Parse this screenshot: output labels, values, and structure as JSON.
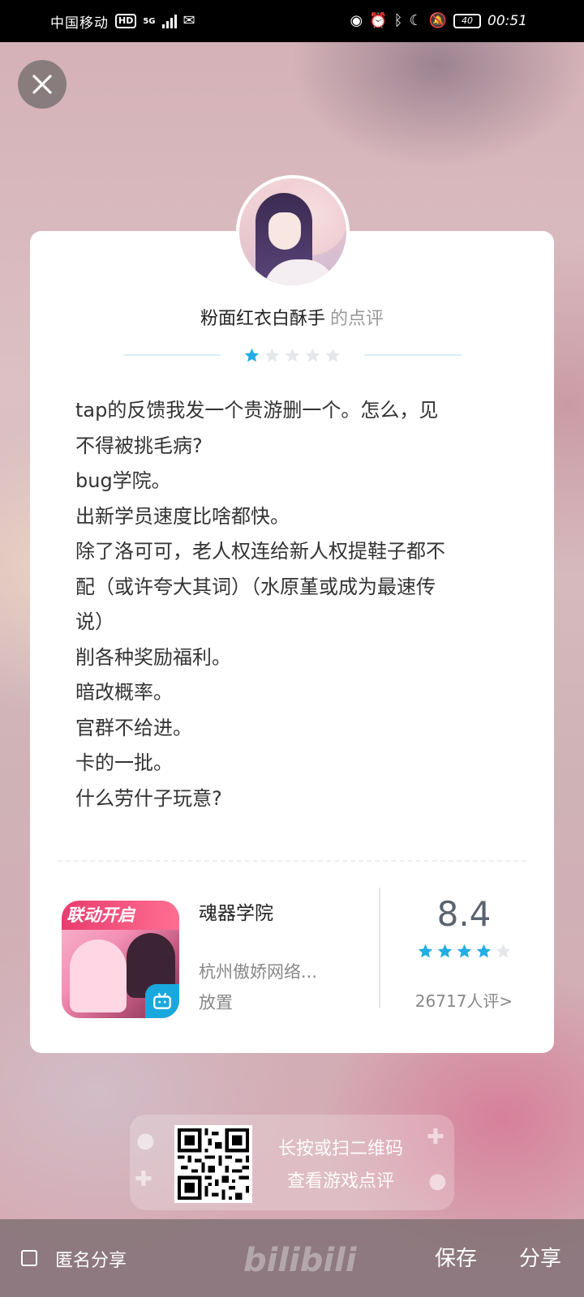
{
  "status_bar": {
    "carrier": "中国移动",
    "hd": "HD",
    "network": "5G",
    "battery": "40",
    "time": "00:51"
  },
  "review": {
    "reviewer": "粉面红衣白酥手",
    "suffix": "的点评",
    "rating_stars": 1,
    "text_lines": [
      "tap的反馈我发一个贵游删一个。怎么，见",
      "不得被挑毛病?",
      "bug学院。",
      "出新学员速度比啥都快。",
      "除了洛可可，老人权连给新人权提鞋子都不",
      "配（或许夸大其词）（水原堇或成为最速传",
      "说）",
      "削各种奖励福利。",
      "暗改概率。",
      "官群不给进。",
      "卡的一批。",
      "什么劳什子玩意?"
    ]
  },
  "game": {
    "banner": "联动开启",
    "name": "魂器学院",
    "developer": "杭州傲娇网络...",
    "genre": "放置",
    "score": "8.4",
    "score_stars": 4,
    "rating_count": "26717人评>"
  },
  "qr": {
    "line1": "长按或扫二维码",
    "line2": "查看游戏点评"
  },
  "bottom": {
    "anonymous_label": "匿名分享",
    "watermark": "bilibili",
    "save_label": "保存",
    "share_label": "分享"
  },
  "colors": {
    "star_active": "#23ade5",
    "star_inactive": "#e5e7ea",
    "accent": "#19a8dd"
  }
}
